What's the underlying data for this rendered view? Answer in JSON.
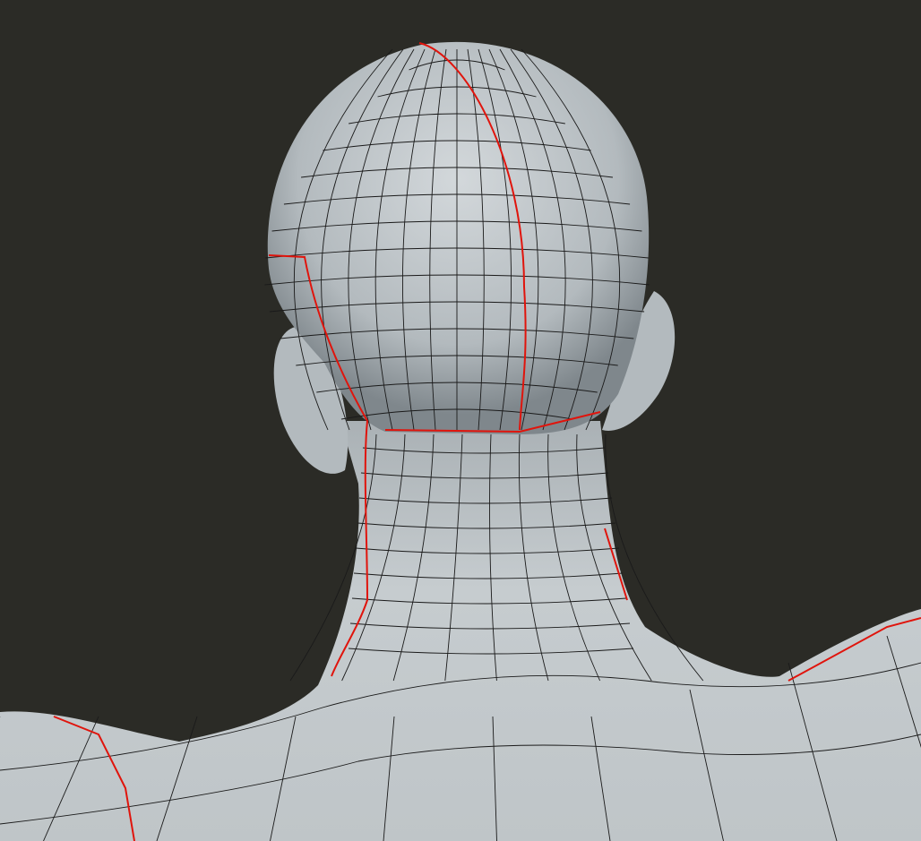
{
  "viewport": {
    "background": "#2b2b26",
    "mesh_color": "#c4cacd",
    "mesh_shadow": "#7f878c",
    "wire_color": "#1a1a1a",
    "seam_color": "#e0140c"
  }
}
